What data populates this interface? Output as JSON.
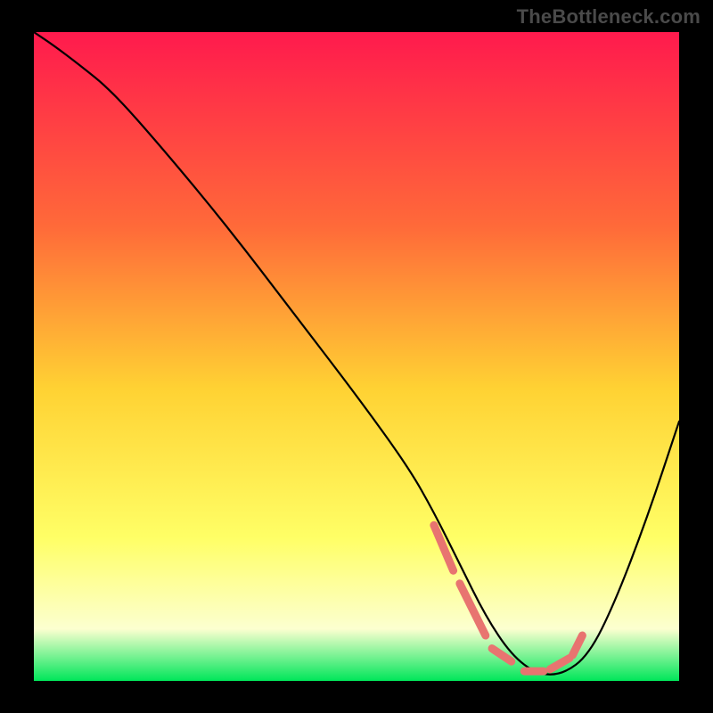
{
  "watermark": "TheBottleneck.com",
  "colors": {
    "background": "#000000",
    "gradient_top": "#ff1a4d",
    "gradient_mid1": "#ff6a39",
    "gradient_mid2": "#ffd233",
    "gradient_mid3": "#ffff66",
    "gradient_mid4": "#fcffd0",
    "gradient_bottom": "#00e65a",
    "curve": "#000000",
    "stubble": "#e87470"
  },
  "chart_data": {
    "type": "line",
    "title": "",
    "xlabel": "",
    "ylabel": "",
    "xlim": [
      0,
      100
    ],
    "ylim": [
      0,
      100
    ],
    "x": [
      0,
      3,
      7,
      12,
      20,
      30,
      40,
      50,
      58,
      62,
      66,
      70,
      74,
      78,
      82,
      86,
      90,
      95,
      100
    ],
    "values": [
      100,
      98,
      95,
      91,
      82,
      70,
      57,
      44,
      33,
      26,
      18,
      10,
      4,
      1,
      1,
      4,
      12,
      25,
      40
    ],
    "stubble_region": {
      "x_start": 62,
      "x_end": 85,
      "segments": [
        {
          "x1": 62,
          "y1": 24,
          "x2": 65,
          "y2": 17
        },
        {
          "x1": 66,
          "y1": 15,
          "x2": 70,
          "y2": 7
        },
        {
          "x1": 71,
          "y1": 5,
          "x2": 74,
          "y2": 3
        },
        {
          "x1": 76,
          "y1": 1.5,
          "x2": 79,
          "y2": 1.5
        },
        {
          "x1": 80,
          "y1": 1.8,
          "x2": 83,
          "y2": 3.5
        },
        {
          "x1": 83.5,
          "y1": 4,
          "x2": 85,
          "y2": 7
        }
      ]
    },
    "annotations": []
  }
}
